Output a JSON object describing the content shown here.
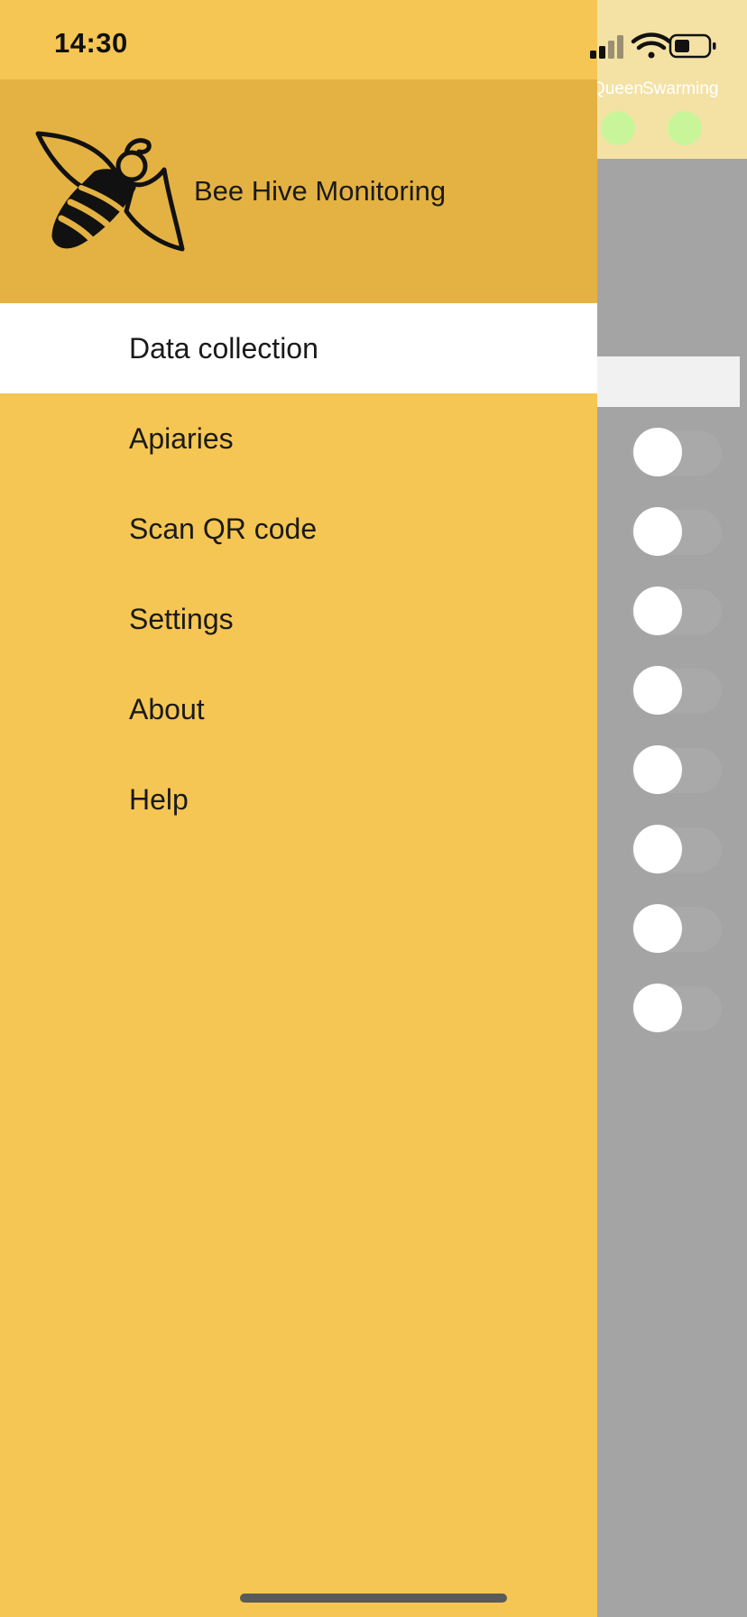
{
  "status_bar": {
    "time": "14:30",
    "icons": [
      "signal-icon",
      "wifi-icon",
      "battery-icon"
    ]
  },
  "background": {
    "columns": [
      "Queen",
      "Swarming"
    ],
    "toggle_count": 8,
    "colors": {
      "top_bar": "#f4e2a5",
      "dim_overlay": "#a4a4a4",
      "dot": "#c9f59a"
    }
  },
  "drawer": {
    "title": "Bee Hive Monitoring",
    "logo_icon": "bee-icon",
    "colors": {
      "body": "#f5c653",
      "header": "#e4b242",
      "active_item": "#ffffff"
    },
    "items": [
      {
        "label": "Data collection",
        "active": true
      },
      {
        "label": "Apiaries",
        "active": false
      },
      {
        "label": "Scan QR code",
        "active": false
      },
      {
        "label": "Settings",
        "active": false
      },
      {
        "label": "About",
        "active": false
      },
      {
        "label": "Help",
        "active": false
      }
    ]
  }
}
